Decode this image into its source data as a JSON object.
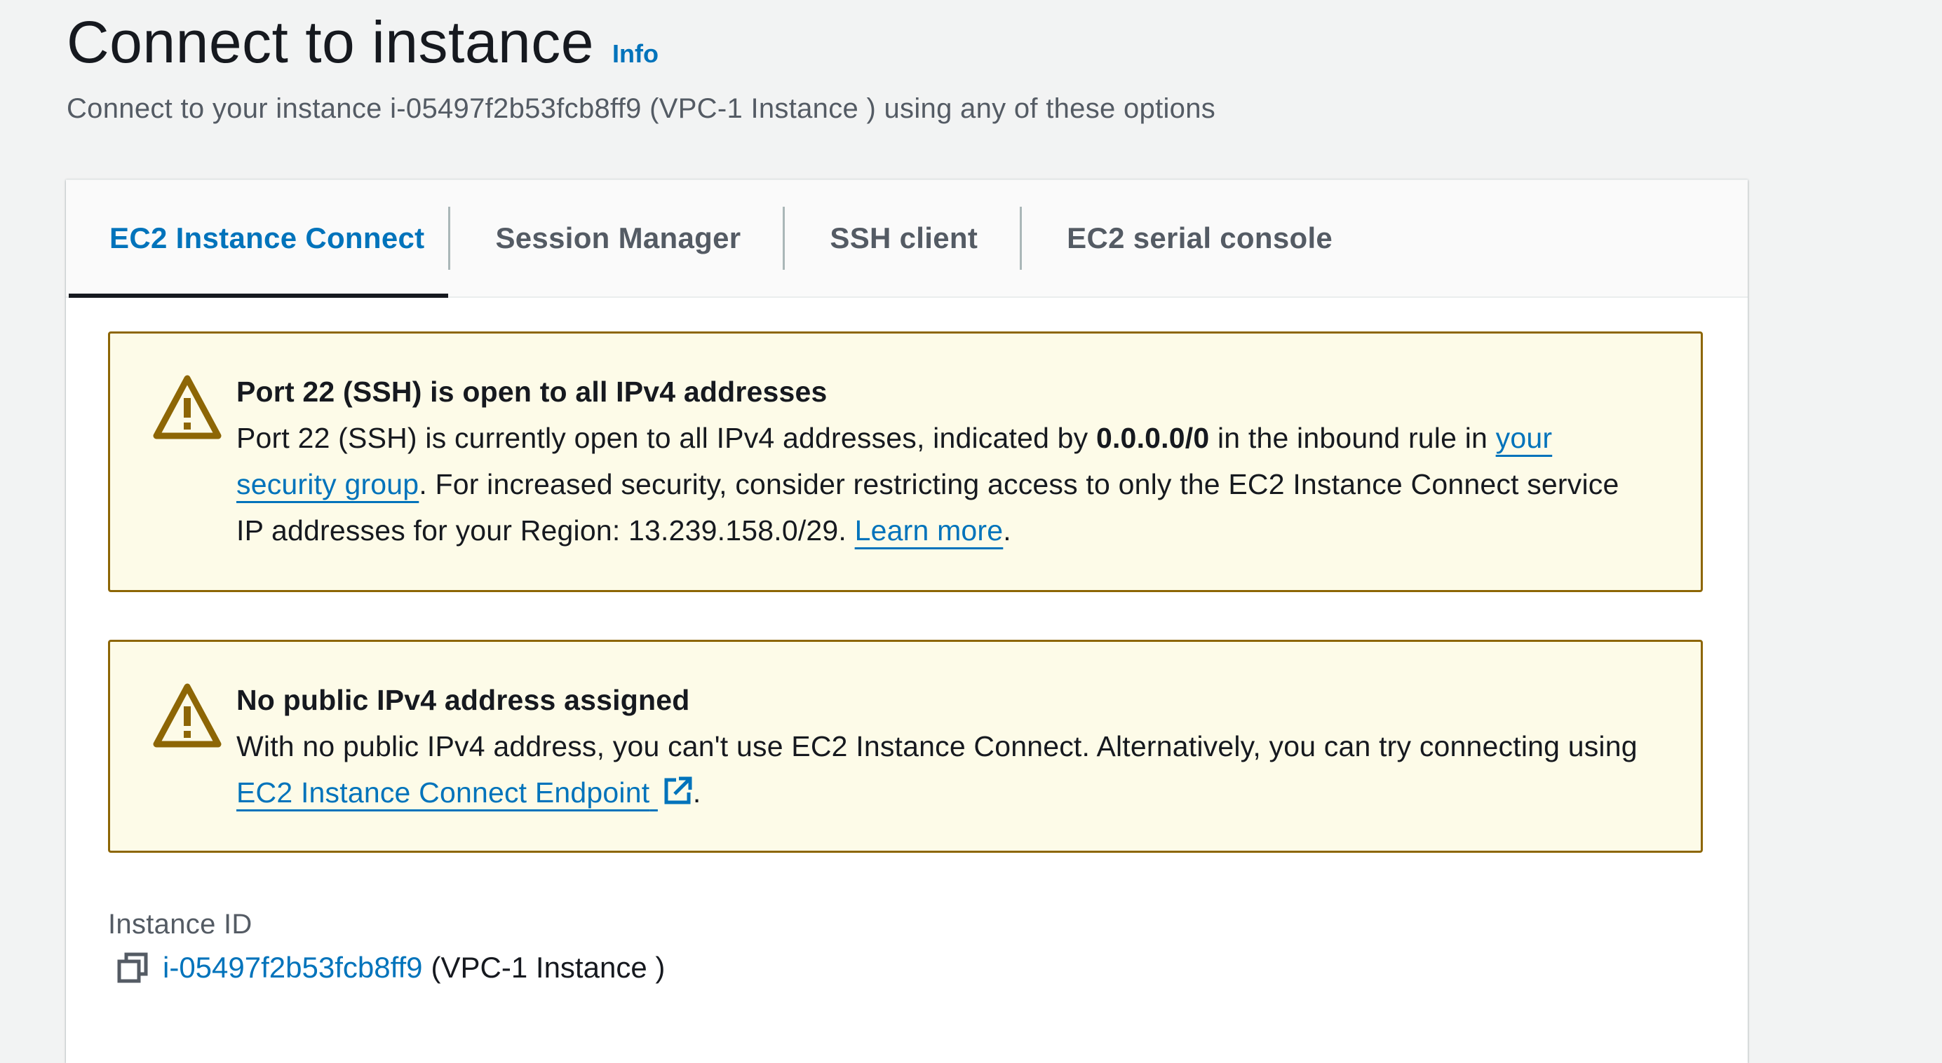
{
  "header": {
    "title": "Connect to instance",
    "info_label": "Info",
    "subtitle": "Connect to your instance i-05497f2b53fcb8ff9 (VPC-1 Instance ) using any of these options"
  },
  "tabs": [
    {
      "label": "EC2 Instance Connect",
      "active": true
    },
    {
      "label": "Session Manager",
      "active": false
    },
    {
      "label": "SSH client",
      "active": false
    },
    {
      "label": "EC2 serial console",
      "active": false
    }
  ],
  "alerts": [
    {
      "icon": "warning-icon",
      "title": "Port 22 (SSH) is open to all IPv4 addresses",
      "text_1": "Port 22 (SSH) is currently open to all IPv4 addresses, indicated by ",
      "bold_1": "0.0.0.0/0",
      "text_2": " in the inbound rule in ",
      "link_1": "your security group",
      "text_3": ". For increased security, consider restricting access to only the EC2 Instance Connect service IP addresses for your Region: 13.239.158.0/29. ",
      "link_2": "Learn more",
      "text_4": "."
    },
    {
      "icon": "warning-icon",
      "title": "No public IPv4 address assigned",
      "text_1": "With no public IPv4 address, you can't use EC2 Instance Connect. Alternatively, you can try connecting using ",
      "link_1": "EC2 Instance Connect Endpoint",
      "text_2": "."
    }
  ],
  "instance": {
    "label": "Instance ID",
    "id": "i-05497f2b53fcb8ff9",
    "name": "(VPC-1 Instance )"
  },
  "colors": {
    "link": "#0073bb",
    "warning_border": "#8d6605",
    "warning_bg": "#fdfbe8",
    "active_tab_underline": "#16191f"
  }
}
